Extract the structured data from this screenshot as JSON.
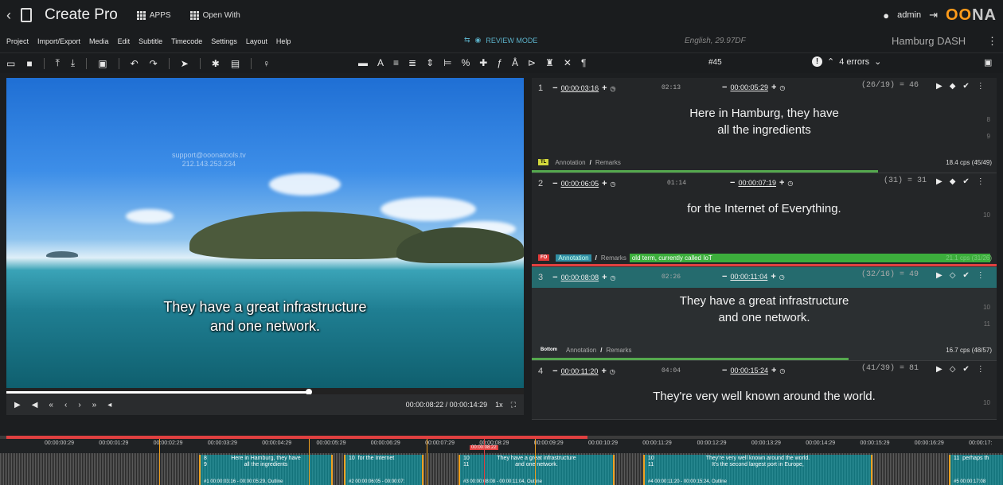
{
  "app": {
    "title": "Create Pro",
    "apps_label": "APPS",
    "open_with_label": "Open With",
    "user": "admin",
    "logo_a": "OO",
    "logo_b": "NA"
  },
  "menu": {
    "items": [
      "Project",
      "Import/Export",
      "Media",
      "Edit",
      "Subtitle",
      "Timecode",
      "Settings",
      "Layout",
      "Help"
    ],
    "review_mode": "REVIEW MODE",
    "language": "English, 29.97DF",
    "profile": "Hamburg DASH"
  },
  "toolbar": {
    "current": "#45",
    "errors": "4 errors"
  },
  "video": {
    "watermark_line1": "support@ooonatools.tv",
    "watermark_line2": "212.143.253.234",
    "subtitle_line1": "They have a great infrastructure",
    "subtitle_line2": "and one network.",
    "timecode": "00:00:08:22 / 00:00:14:29",
    "speed": "1x",
    "progress": 0.585
  },
  "subtitles": [
    {
      "n": "1",
      "in": "00:00:03:16",
      "dur": "02:13",
      "out": "00:00:05:29",
      "count": "(26/19) = 46",
      "line1": "Here in Hamburg, they have",
      "line2": "all the ingredients",
      "lnums": [
        "8",
        "9"
      ],
      "tag": "TL",
      "annotation": "Annotation",
      "remarks": "Remarks",
      "cps": "18.4 cps (45/49)"
    },
    {
      "n": "2",
      "in": "00:00:06:05",
      "dur": "01:14",
      "out": "00:00:07:19",
      "count": "(31) = 31",
      "line1": "for the Internet of Everything.",
      "line2": "",
      "lnums": [
        "10"
      ],
      "tag": "FO",
      "annotation": "Annotation",
      "remarks": "Remarks",
      "note": "old term, currently called IoT",
      "cps": "21.1 cps (31/26)"
    },
    {
      "n": "3",
      "in": "00:00:08:08",
      "dur": "02:26",
      "out": "00:00:11:04",
      "count": "(32/16) = 49",
      "line1": "They have a great infrastructure",
      "line2": "and one network.",
      "lnums": [
        "10",
        "11"
      ],
      "tag": "Bottom",
      "annotation": "Annotation",
      "remarks": "Remarks",
      "cps": "16.7 cps (48/57)"
    },
    {
      "n": "4",
      "in": "00:00:11:20",
      "dur": "04:04",
      "out": "00:00:15:24",
      "count": "(41/39) = 81",
      "line1": "They're very well known around the world.",
      "line2": "",
      "lnums": [
        "10"
      ]
    }
  ],
  "timeline": {
    "ticks": [
      "00:00:00:29",
      "00:00:01:29",
      "00:00:02:29",
      "00:00:03:29",
      "00:00:04:29",
      "00:00:05:29",
      "00:00:06:29",
      "00:00:07:29",
      "00:00:08:29",
      "00:00:09:29",
      "00:00:10:29",
      "00:00:11:29",
      "00:00:12:29",
      "00:00:13:29",
      "00:00:14:29",
      "00:00:15:29",
      "00:00:16:29",
      "00:00:17:"
    ],
    "playhead": "00:00:08:22",
    "segments": [
      {
        "top": "8",
        "mid": "9",
        "line1": "Here in Hamburg, they have",
        "line2": "all the ingredients",
        "bottom": "#1 00:00:03:16 - 00:00:05:29, Outline"
      },
      {
        "top": "10",
        "mid": "",
        "line1": "for the Internet",
        "line2": "",
        "bottom": "#2 00:00:06:05 - 00:00:07:"
      },
      {
        "top": "10",
        "mid": "11",
        "line1": "They have a great infrastructure",
        "line2": "and one network.",
        "bottom": "#3 00:00:08:08 - 00:00:11:04, Outline"
      },
      {
        "top": "10",
        "mid": "11",
        "line1": "They're very well known around the world.",
        "line2": "It's the second largest port in Europe,",
        "bottom": "#4 00:00:11:20 - 00:00:15:24, Outline"
      },
      {
        "top": "11",
        "mid": "",
        "line1": "perhaps th",
        "line2": "",
        "bottom": "#5 00:00:17:08"
      }
    ]
  }
}
